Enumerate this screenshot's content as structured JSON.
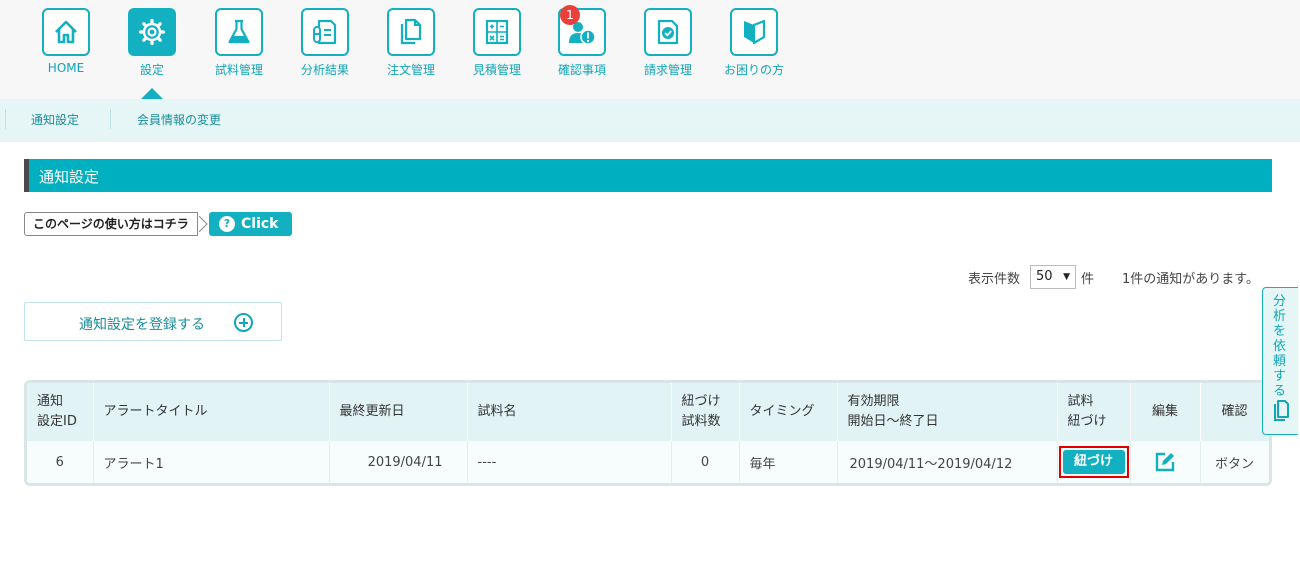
{
  "nav": {
    "items": [
      {
        "label": "HOME",
        "icon": "home-icon"
      },
      {
        "label": "設定",
        "icon": "gear-icon"
      },
      {
        "label": "試料管理",
        "icon": "flask-icon"
      },
      {
        "label": "分析結果",
        "icon": "test-tube-document-icon"
      },
      {
        "label": "注文管理",
        "icon": "copy-documents-icon"
      },
      {
        "label": "見積管理",
        "icon": "calculator-icon"
      },
      {
        "label": "確認事項",
        "icon": "user-alert-icon",
        "badge": "1"
      },
      {
        "label": "請求管理",
        "icon": "check-document-icon"
      },
      {
        "label": "お困りの方",
        "icon": "beginner-leaf-icon"
      }
    ],
    "active": "設定"
  },
  "subnav": {
    "items": [
      "通知設定",
      "会員情報の変更"
    ]
  },
  "section": {
    "title": "通知設定"
  },
  "help": {
    "tag_text": "このページの使い方はコチラ",
    "button_label": "Click",
    "button_icon": "?"
  },
  "display": {
    "count_label": "表示件数",
    "count_value": "50",
    "count_arrow": "▼",
    "count_unit": "件",
    "message": "1件の通知があります。"
  },
  "register": {
    "label": "通知設定を登録する"
  },
  "table": {
    "headers": {
      "id": [
        "通知",
        "設定ID"
      ],
      "title": "アラートタイトル",
      "updated": "最終更新日",
      "sample_name": "試料名",
      "linked_count": [
        "紐づけ",
        "試料数"
      ],
      "timing": "タイミング",
      "period": [
        "有効期限",
        "開始日～終了日"
      ],
      "link": [
        "試料",
        "紐づけ"
      ],
      "edit": "編集",
      "confirm": "確認"
    },
    "rows": [
      {
        "id": "6",
        "title": "アラート1",
        "updated": "2019/04/11",
        "sample_name": "----",
        "linked_count": "0",
        "timing": "毎年",
        "period": "2019/04/11～2019/04/12",
        "link_button": "紐づけ",
        "confirm": "ボタン"
      }
    ]
  },
  "side_tab": {
    "label": "分析を依頼する"
  },
  "colors": {
    "accent": "#12b0c0",
    "header_bg": "#00b0c0",
    "highlight": "#e00000",
    "badge": "#e8403a"
  }
}
